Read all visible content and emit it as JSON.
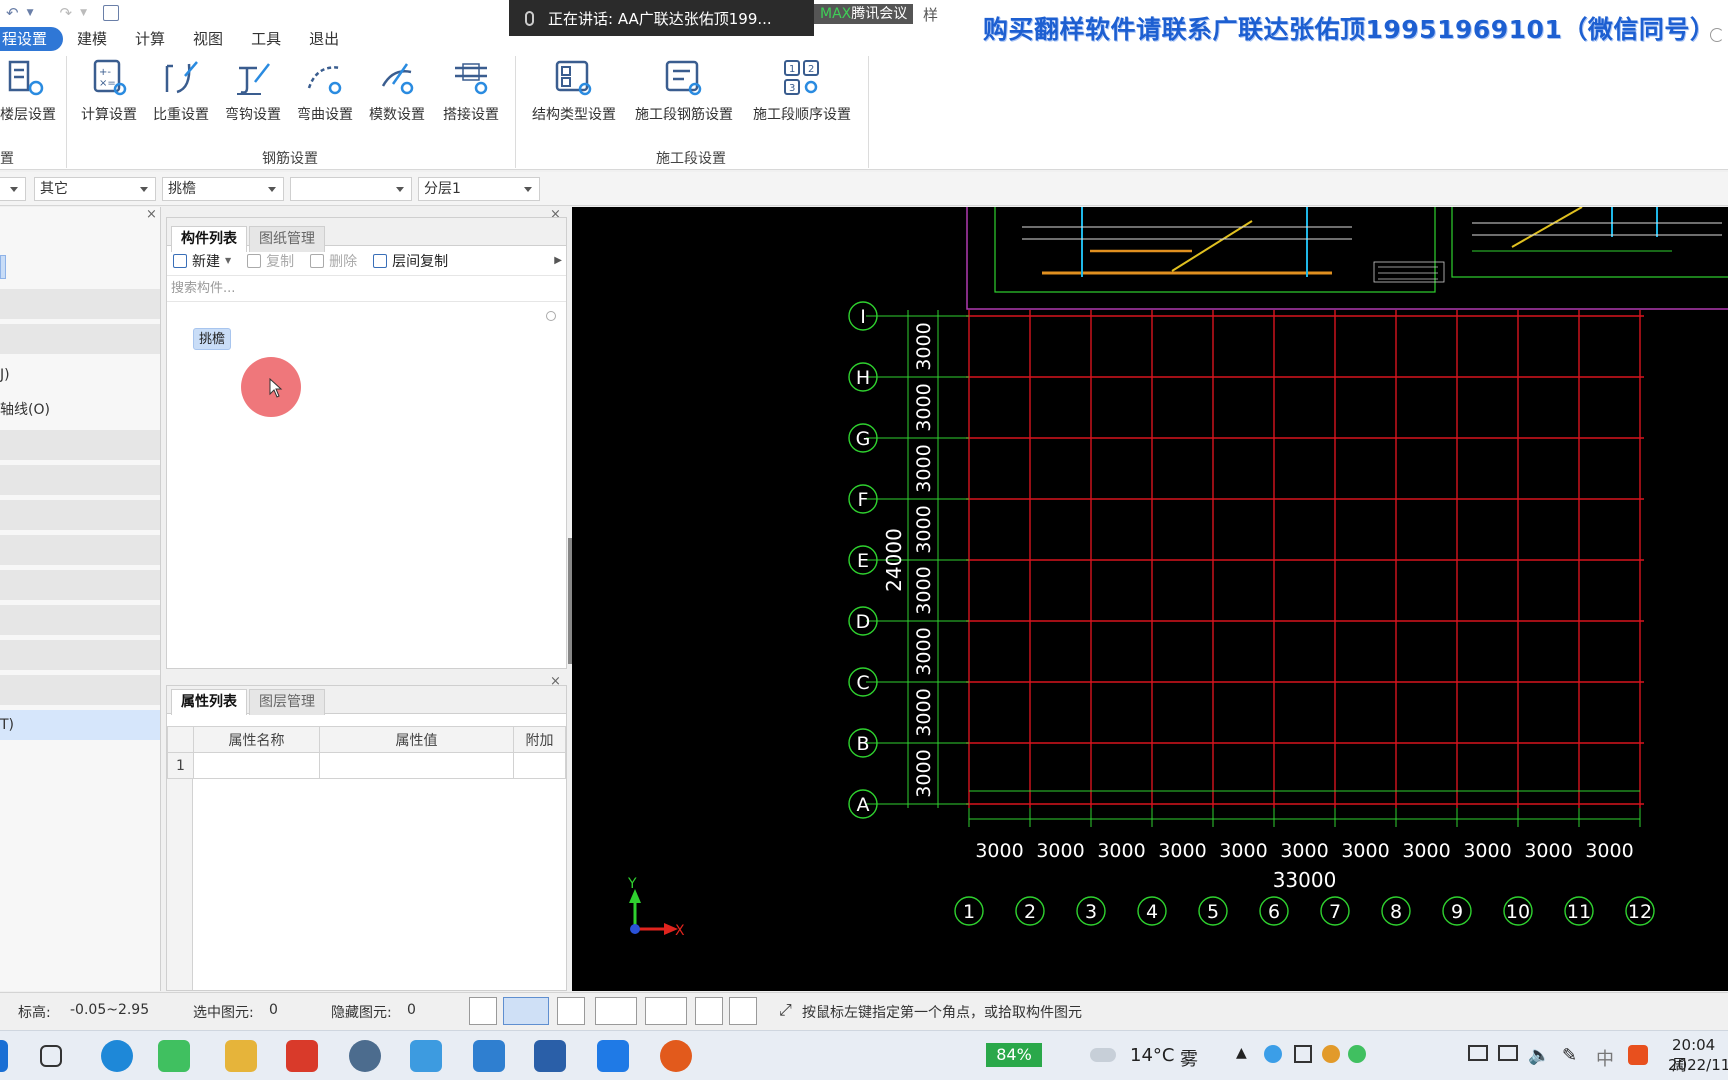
{
  "quick_access": {
    "undo": "↶",
    "redo": "↷"
  },
  "menu": {
    "tabs": [
      "程设置",
      "建模",
      "计算",
      "视图",
      "工具",
      "退出"
    ]
  },
  "meeting": {
    "speaking": "正在讲话: AA广联达张佑顶199...",
    "app_prefix": "MAX",
    "app": "腾讯会议",
    "tail": "样"
  },
  "ad_banner": "购买翻样软件请联系广联达张佑顶19951969101（微信同号）",
  "ribbon": {
    "buttons": [
      "楼层设置",
      "计算设置",
      "比重设置",
      "弯钩设置",
      "弯曲设置",
      "模数设置",
      "搭接设置",
      "结构类型设置",
      "施工段钢筋设置",
      "施工段顺序设置"
    ],
    "groups": [
      "置",
      "钢筋设置",
      "施工段设置"
    ]
  },
  "filters": [
    "其它",
    "挑檐",
    "",
    "分层1"
  ],
  "leftnav": {
    "items": [
      "J)",
      "轴线(O)",
      "T)"
    ]
  },
  "component_panel": {
    "tabs": [
      "构件列表",
      "图纸管理"
    ],
    "toolbar": [
      "新建",
      "复制",
      "删除",
      "层间复制"
    ],
    "search_placeholder": "搜索构件...",
    "item": "挑檐"
  },
  "property_panel": {
    "tabs": [
      "属性列表",
      "图层管理"
    ],
    "headers": [
      "属性名称",
      "属性值",
      "附加"
    ],
    "rows": [
      {
        "idx": "1",
        "name": "",
        "value": "",
        "extra": ""
      }
    ]
  },
  "drawing": {
    "row_axes": [
      "I",
      "H",
      "G",
      "F",
      "E",
      "D",
      "C",
      "B",
      "A"
    ],
    "col_axes": [
      "1",
      "2",
      "3",
      "4",
      "5",
      "6",
      "7",
      "8",
      "9",
      "10",
      "11",
      "12"
    ],
    "spacing_label": "3000",
    "vertical_total": "24000",
    "horizontal_total": "33000",
    "ucs_x": "X",
    "ucs_y": "Y"
  },
  "statusbar": {
    "elevation_label": "标高:",
    "elevation_value": "-0.05~2.95",
    "selected_label": "选中图元:",
    "selected_value": "0",
    "hidden_label": "隐藏图元:",
    "hidden_value": "0",
    "hint": "按鼠标左键指定第一个角点，或拾取构件图元"
  },
  "taskbar": {
    "battery": "84%",
    "weather_temp": "14°C",
    "weather_text": "雾",
    "ime": "中",
    "time": "20:04 周",
    "date": "2022/11"
  },
  "colors": {
    "accent": "#2f77d6",
    "grid_red": "#d7141e",
    "dim_green": "#2fd12f",
    "magenta": "#b03bb0",
    "ad_blue": "#1d5fd1"
  }
}
